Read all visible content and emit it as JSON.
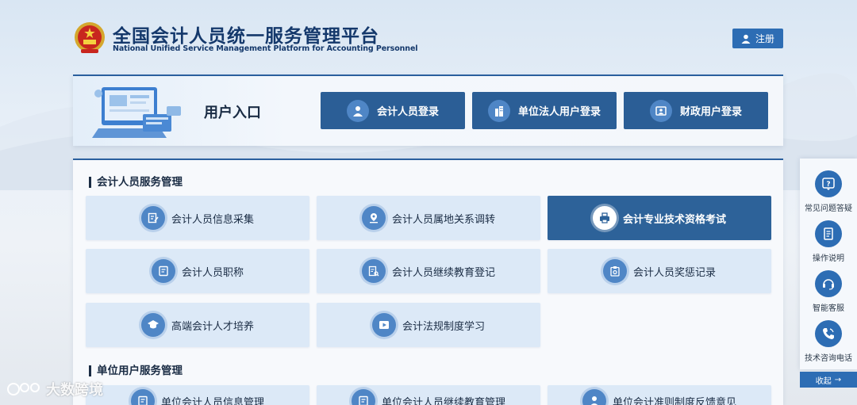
{
  "header": {
    "title_cn": "全国会计人员统一服务管理平台",
    "title_en": "National Unified Service Management Platform for Accounting Personnel",
    "emblem_icon": "national-emblem-icon",
    "register_label": "注册"
  },
  "entry": {
    "label": "用户入口",
    "buttons": [
      {
        "label": "会计人员登录",
        "icon": "user-icon"
      },
      {
        "label": "单位法人用户登录",
        "icon": "building-icon"
      },
      {
        "label": "财政用户登录",
        "icon": "id-card-icon"
      }
    ]
  },
  "sections": [
    {
      "title": "会计人员服务管理",
      "cards": [
        {
          "label": "会计人员信息采集",
          "icon": "edit-form-icon"
        },
        {
          "label": "会计人员属地关系调转",
          "icon": "location-icon"
        },
        {
          "label": "会计专业技术资格考试",
          "icon": "printer-icon",
          "active": true
        },
        {
          "label": "会计人员职称",
          "icon": "document-icon"
        },
        {
          "label": "会计人员继续教育登记",
          "icon": "search-document-icon"
        },
        {
          "label": "会计人员奖惩记录",
          "icon": "clipboard-icon"
        },
        {
          "label": "高端会计人才培养",
          "icon": "graduation-cap-icon"
        },
        {
          "label": "会计法规制度学习",
          "icon": "play-icon"
        }
      ]
    },
    {
      "title": "单位用户服务管理",
      "cards": [
        {
          "label": "单位会计人员信息管理",
          "icon": "document-icon"
        },
        {
          "label": "单位会计人员继续教育管理",
          "icon": "document-icon"
        },
        {
          "label": "单位会计准则制度反馈意见",
          "icon": "user-icon"
        }
      ]
    }
  ],
  "sidebar": {
    "items": [
      {
        "label": "常见问题答疑",
        "icon": "question-icon"
      },
      {
        "label": "操作说明",
        "icon": "manual-icon"
      },
      {
        "label": "智能客服",
        "icon": "headset-icon"
      },
      {
        "label": "技术咨询电话",
        "icon": "phone-icon"
      }
    ],
    "collapse_label": "收起",
    "collapse_arrow": "→"
  },
  "watermark": {
    "text": "大数跨境"
  },
  "colors": {
    "primary": "#2d6db4",
    "dark_blue": "#2b5e96",
    "card_bg": "#dce9f7"
  }
}
